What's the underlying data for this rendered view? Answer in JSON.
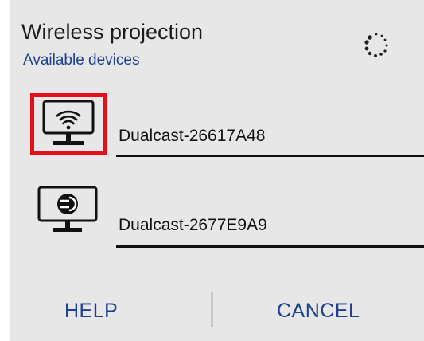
{
  "dialog": {
    "title": "Wireless projection",
    "subtitle": "Available devices",
    "spinner_icon": "loading-spinner-icon"
  },
  "devices": [
    {
      "name": "Dualcast-26617A48",
      "icon": "monitor-wifi-icon",
      "selected": true
    },
    {
      "name": "Dualcast-2677E9A9",
      "icon": "monitor-connected-icon",
      "selected": false
    }
  ],
  "buttons": {
    "help": "HELP",
    "cancel": "CANCEL"
  },
  "colors": {
    "background": "#e7e7e7",
    "accent": "#1f3f8f",
    "selection": "#e3101c",
    "text": "#1b1b1b"
  }
}
